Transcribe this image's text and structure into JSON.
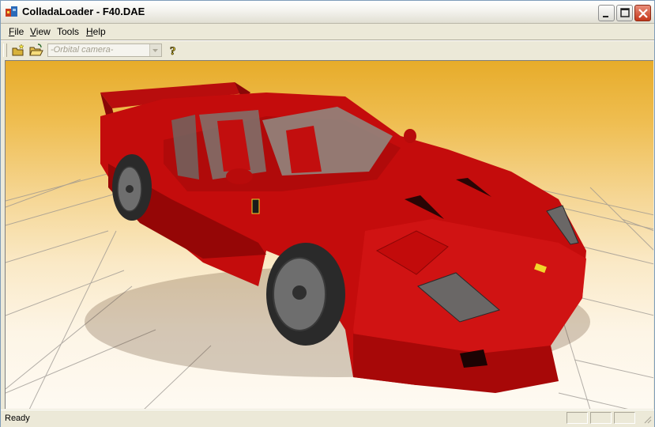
{
  "window": {
    "title": "ColladaLoader - F40.DAE"
  },
  "menu": {
    "file": {
      "first": "F",
      "rest": "ile"
    },
    "view": {
      "first": "V",
      "rest": "iew"
    },
    "tools": {
      "first": "T",
      "rest": "ools"
    },
    "help": {
      "first": "H",
      "rest": "elp"
    }
  },
  "toolbar": {
    "camera_select": "-Orbital camera-",
    "icons": [
      "new-scene-icon",
      "open-folder-icon",
      "help-icon"
    ]
  },
  "viewport": {
    "subject": "red Ferrari F40 3D model",
    "colors": {
      "sky_top": "#e7ac2a",
      "sky_bottom": "#fefaf2",
      "car_red": "#c40c0c"
    }
  },
  "status": {
    "text": "Ready"
  }
}
